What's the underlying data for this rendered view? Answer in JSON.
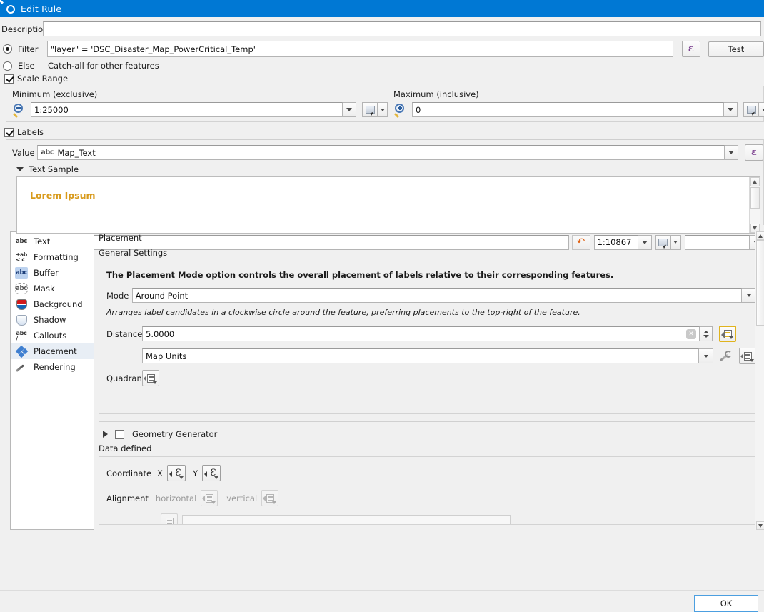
{
  "window": {
    "title": "Edit Rule",
    "icon": "qgis-logo-icon",
    "accent_color": "#0078d4"
  },
  "form": {
    "description_label": "Description",
    "description_value": "",
    "description_placeholder": "",
    "filter_label": "Filter",
    "filter_selected": true,
    "filter_value": "\"layer\"  =  'DSC_Disaster_Map_PowerCritical_Temp'",
    "filter_expression_button": "ε",
    "test_button": "Test",
    "else_label": "Else",
    "else_selected": false,
    "else_hint": "Catch-all for other features"
  },
  "scale_range": {
    "checkbox_label": "Scale Range",
    "checked": true,
    "minimum_label": "Minimum (exclusive)",
    "minimum_value": "1:25000",
    "maximum_label": "Maximum (inclusive)",
    "maximum_value": "0"
  },
  "labels": {
    "checkbox_label": "Labels",
    "checked": true,
    "value_label": "Value",
    "value_type_tag": "abc",
    "value_field": "Map_Text",
    "value_expression_button": "ε",
    "text_sample_label": "Text Sample",
    "text_sample_expanded": true,
    "preview_text": "Lorem Ipsum",
    "sample_input_value": "Lorem Ipsum",
    "preview_scale": "1:10867",
    "preview_extra_value": ""
  },
  "sidebar": {
    "items": [
      {
        "label": "Text",
        "icon": "abc-text-icon",
        "selected": false
      },
      {
        "label": "Formatting",
        "icon": "formatting-icon",
        "selected": false
      },
      {
        "label": "Buffer",
        "icon": "abc-buffer-icon",
        "selected": false
      },
      {
        "label": "Mask",
        "icon": "abc-mask-icon",
        "selected": false
      },
      {
        "label": "Background",
        "icon": "background-shield-icon",
        "selected": false
      },
      {
        "label": "Shadow",
        "icon": "shadow-shield-icon",
        "selected": false
      },
      {
        "label": "Callouts",
        "icon": "callouts-icon",
        "selected": false
      },
      {
        "label": "Placement",
        "icon": "placement-diamond-icon",
        "selected": true
      },
      {
        "label": "Rendering",
        "icon": "brush-icon",
        "selected": false
      }
    ]
  },
  "placement": {
    "panel_title": "Placement",
    "section_title": "General Settings",
    "hint": "The Placement Mode option controls the overall placement of labels relative to their corresponding features.",
    "mode_label": "Mode",
    "mode_value": "Around Point",
    "mode_description": "Arranges label candidates in a clockwise circle around the feature, preferring placements to the top-right of the feature.",
    "distance_label": "Distance",
    "distance_value": "5.0000",
    "units_value": "Map Units",
    "quadrant_label": "Quadrant"
  },
  "geometry_generator": {
    "label": "Geometry Generator",
    "checked": false,
    "expanded": false
  },
  "data_defined": {
    "title": "Data defined",
    "coordinate_label": "Coordinate",
    "coordinate_x_label": "X",
    "coordinate_y_label": "Y",
    "alignment_label": "Alignment",
    "alignment_horizontal_label": "horizontal",
    "alignment_vertical_label": "vertical"
  },
  "footer": {
    "ok_button": "OK"
  }
}
